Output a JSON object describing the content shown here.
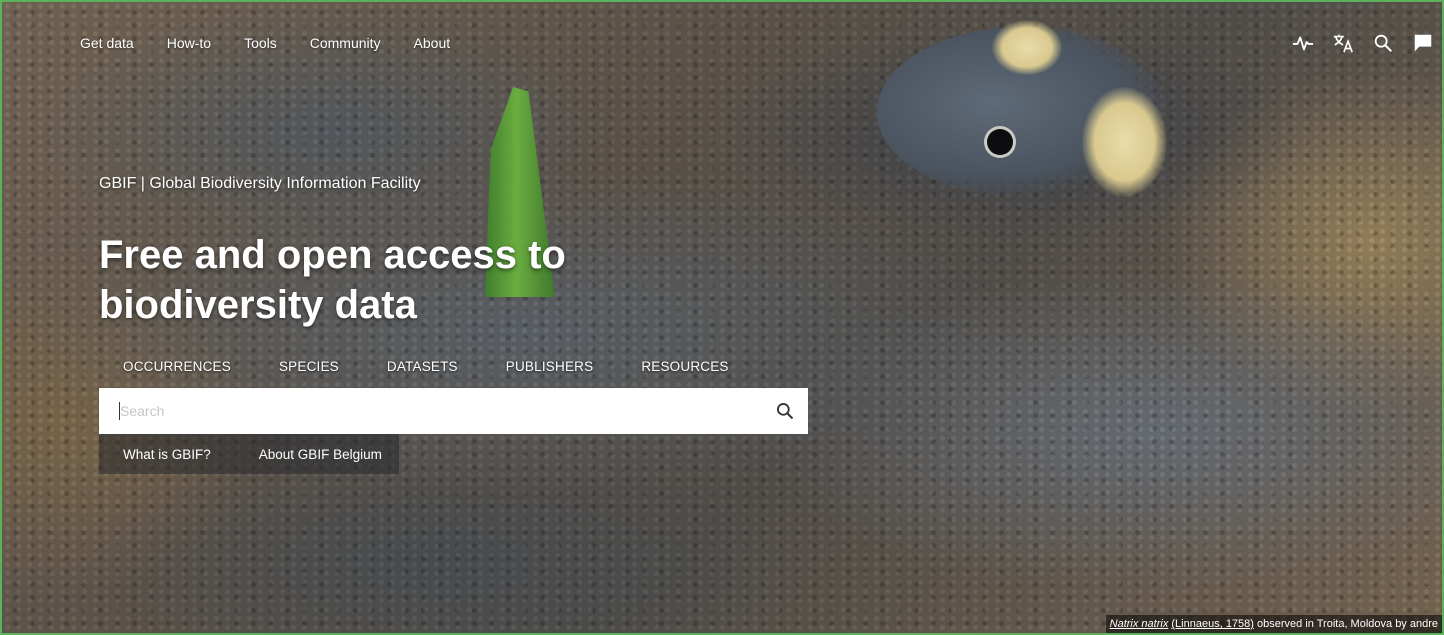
{
  "nav": {
    "items": [
      "Get data",
      "How-to",
      "Tools",
      "Community",
      "About"
    ]
  },
  "icons": [
    "pulse-icon",
    "translate-icon",
    "search-icon",
    "feedback-icon"
  ],
  "hero": {
    "site_name": "GBIF | Global Biodiversity Information Facility",
    "headline_line1": "Free and open access to",
    "headline_line2": "biodiversity data"
  },
  "search": {
    "tabs": [
      "OCCURRENCES",
      "SPECIES",
      "DATASETS",
      "PUBLISHERS",
      "RESOURCES"
    ],
    "placeholder": "Search",
    "quick_links": [
      "What is GBIF?",
      "About GBIF Belgium"
    ]
  },
  "credit": {
    "species": "Natrix natrix",
    "authority": "(Linnaeus, 1758)",
    "text": " observed in Troita, Moldova by andre"
  },
  "colors": {
    "frame_border": "#5cb25c",
    "text": "#ffffff",
    "search_bg": "#ffffff"
  }
}
